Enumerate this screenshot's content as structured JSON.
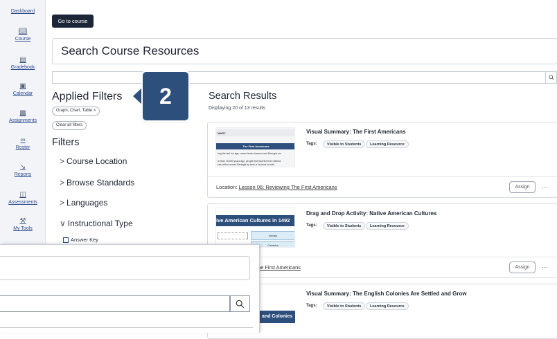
{
  "sidebar": {
    "items": [
      {
        "label": "Dashboard",
        "icon": ""
      },
      {
        "label": "Course",
        "icon": "book-icon"
      },
      {
        "label": "Gradebook",
        "icon": "gradebook-icon"
      },
      {
        "label": "Calendar",
        "icon": "calendar-icon"
      },
      {
        "label": "Assignments",
        "icon": "assignments-icon"
      },
      {
        "label": "Roster",
        "icon": "roster-icon"
      },
      {
        "label": "Reports",
        "icon": "reports-icon"
      },
      {
        "label": "Assessments",
        "icon": "assessments-icon"
      },
      {
        "label": "My Tools",
        "icon": "tools-icon"
      }
    ]
  },
  "header": {
    "go_button": "Go to course",
    "title": "Search Course Resources"
  },
  "filters": {
    "applied_title": "Applied Filters",
    "applied_chip": "Graph, Chart, Table ×",
    "clear_label": "Clear all filters",
    "filters_title": "Filters",
    "groups": [
      {
        "chevron": ">",
        "label": "Course Location"
      },
      {
        "chevron": ">",
        "label": "Browse Standards"
      },
      {
        "chevron": ">",
        "label": "Languages"
      },
      {
        "chevron": "∨",
        "label": "Instructional Type"
      }
    ],
    "checkbox": "Answer Key"
  },
  "badge": {
    "number": "2"
  },
  "results": {
    "title": "Search Results",
    "subtitle": "Displaying 20 of 13 results",
    "tags_label": "Tags:",
    "assign_label": "Assign",
    "more_label": "···",
    "location_prefix": "Location:",
    "cards": [
      {
        "title": "Visual Summary: The First Americans",
        "tags": [
          "Visible to Students",
          "Learning Resource"
        ],
        "location": "Lesson 06: Reviewing The First Americans",
        "thumb_head": "MARY",
        "thumb_banner": "The First Americans",
        "thumb_line1": "ring the last Ice age, ocean levels lowered and Beringia em",
        "thumb_line2": "re than 15,000 years ago, people first traveled from Siberia",
        "thumb_line3": "ska, either across Beringia by land or by boat or both."
      },
      {
        "title": "Drag and Drop Activity: Native American Cultures",
        "tags": [
          "Visible to Students",
          "Learning Resource"
        ],
        "location": "n 06: Reviewing The First Americans",
        "thumb_banner": "ive American Cultures in 1492",
        "thumb_cell1": "Navajo",
        "thumb_cell2": "Catawba"
      },
      {
        "title": "Visual Summary: The English Colonies Are Settled and Grow",
        "tags": [
          "Visible to Students",
          "Learning Resource"
        ],
        "thumb_banner": "and Colonies"
      }
    ]
  },
  "colors": {
    "accent": "#2d4f7c",
    "button_dark": "#1d2638",
    "link": "#2b4a8f"
  }
}
